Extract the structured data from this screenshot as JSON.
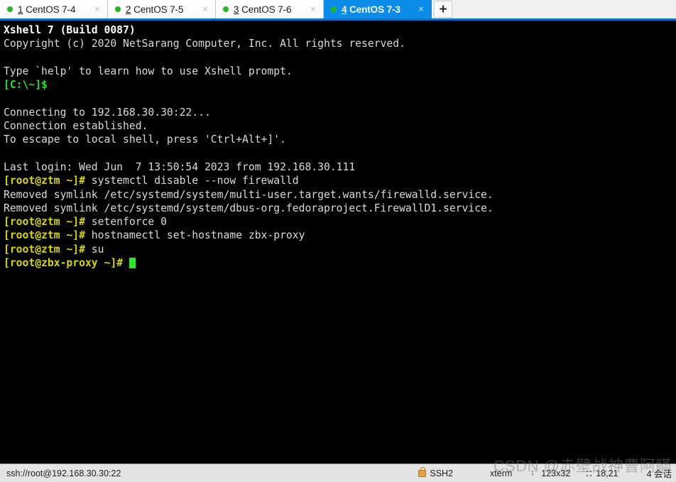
{
  "tabbar": {
    "tabs": [
      {
        "num": "1",
        "title": "CentOS 7-4",
        "active": false,
        "close": "×",
        "status_dot": "connected-dot"
      },
      {
        "num": "2",
        "title": "CentOS 7-5",
        "active": false,
        "close": "×",
        "status_dot": "connected-dot"
      },
      {
        "num": "3",
        "title": "CentOS 7-6",
        "active": false,
        "close": "×",
        "status_dot": "connected-dot"
      },
      {
        "num": "4",
        "title": "CentOS 7-3",
        "active": true,
        "close": "×",
        "status_dot": "connected-dot"
      }
    ],
    "new_tab_label": "+"
  },
  "terminal": {
    "lines": [
      {
        "segments": [
          {
            "text": "Xshell 7 (Build 0087)",
            "color": "bold"
          }
        ]
      },
      {
        "segments": [
          {
            "text": "Copyright (c) 2020 NetSarang Computer, Inc. All rights reserved.",
            "color": "white"
          }
        ]
      },
      {
        "segments": [
          {
            "text": "",
            "color": "white"
          }
        ]
      },
      {
        "segments": [
          {
            "text": "Type `help' to learn how to use Xshell prompt.",
            "color": "white"
          }
        ]
      },
      {
        "segments": [
          {
            "text": "[C:\\~]$",
            "color": "green"
          }
        ]
      },
      {
        "segments": [
          {
            "text": "",
            "color": "white"
          }
        ]
      },
      {
        "segments": [
          {
            "text": "Connecting to 192.168.30.30:22...",
            "color": "white"
          }
        ]
      },
      {
        "segments": [
          {
            "text": "Connection established.",
            "color": "white"
          }
        ]
      },
      {
        "segments": [
          {
            "text": "To escape to local shell, press 'Ctrl+Alt+]'.",
            "color": "white"
          }
        ]
      },
      {
        "segments": [
          {
            "text": "",
            "color": "white"
          }
        ]
      },
      {
        "segments": [
          {
            "text": "Last login: Wed Jun  7 13:50:54 2023 from 192.168.30.111",
            "color": "white"
          }
        ]
      },
      {
        "segments": [
          {
            "text": "[root@ztm ~]#",
            "color": "yellow"
          },
          {
            "text": " systemctl disable --now firewalld",
            "color": "white"
          }
        ]
      },
      {
        "segments": [
          {
            "text": "Removed symlink /etc/systemd/system/multi-user.target.wants/firewalld.service.",
            "color": "white"
          }
        ]
      },
      {
        "segments": [
          {
            "text": "Removed symlink /etc/systemd/system/dbus-org.fedoraproject.FirewallD1.service.",
            "color": "white"
          }
        ]
      },
      {
        "segments": [
          {
            "text": "[root@ztm ~]#",
            "color": "yellow"
          },
          {
            "text": " setenforce 0",
            "color": "white"
          }
        ]
      },
      {
        "segments": [
          {
            "text": "[root@ztm ~]#",
            "color": "yellow"
          },
          {
            "text": " hostnamectl set-hostname zbx-proxy",
            "color": "white"
          }
        ]
      },
      {
        "segments": [
          {
            "text": "[root@ztm ~]#",
            "color": "yellow"
          },
          {
            "text": " su",
            "color": "white"
          }
        ]
      },
      {
        "segments": [
          {
            "text": "[root@zbx-proxy ~]#",
            "color": "yellow"
          },
          {
            "text": " ",
            "color": "white"
          }
        ],
        "cursor": true
      }
    ]
  },
  "statusbar": {
    "url": "ssh://root@192.168.30.30:22",
    "protocol": "SSH2",
    "terminal_type": "xterm",
    "size": "123x32",
    "cursor_position": "18,21",
    "sessions": "4 会话"
  },
  "watermark": {
    "text": "CSDN @赤壁战神曹阿瞞"
  }
}
